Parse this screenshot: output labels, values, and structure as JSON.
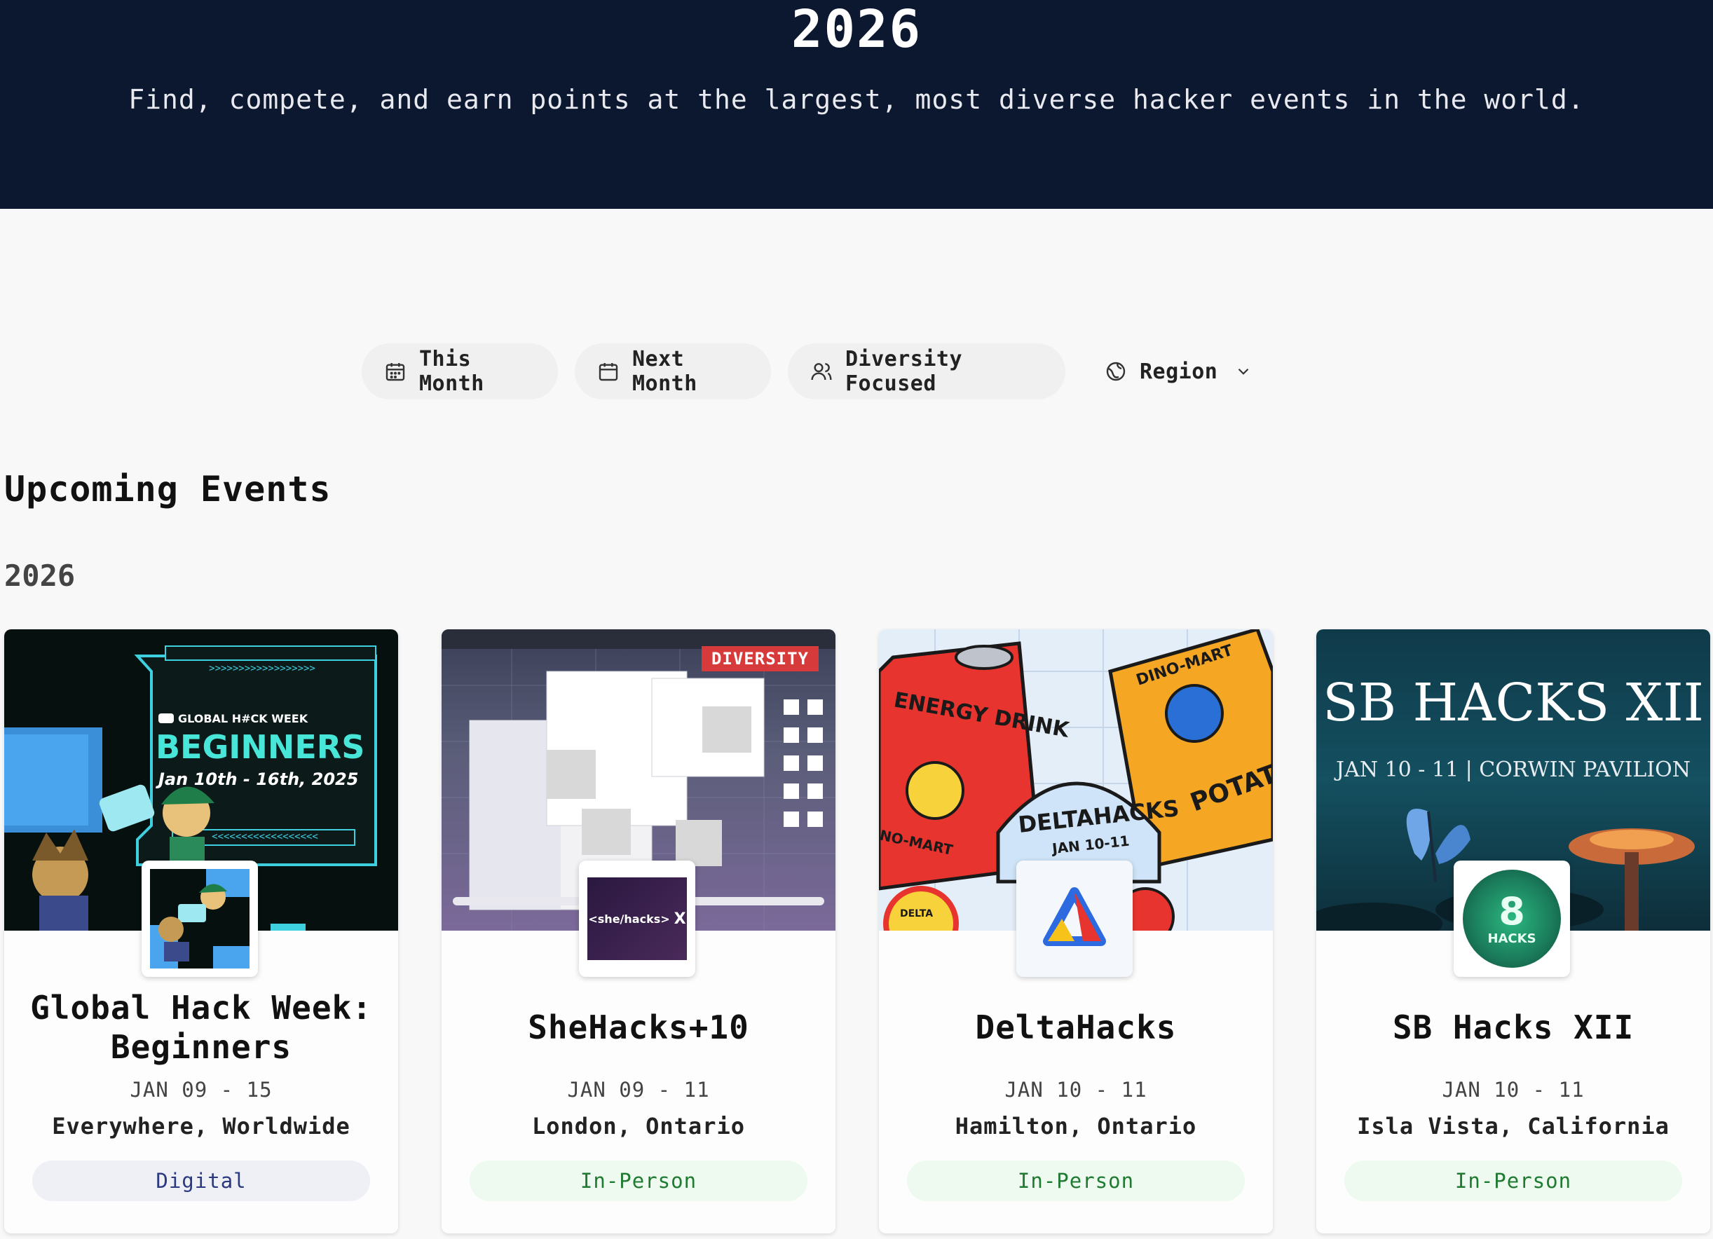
{
  "hero": {
    "title": "2026",
    "subtitle": "Find, compete, and earn points at the largest, most diverse hacker events in the world."
  },
  "filters": [
    {
      "label": "This Month",
      "icon": "calendar-icon"
    },
    {
      "label": "Next Month",
      "icon": "calendar-icon"
    },
    {
      "label": "Diversity Focused",
      "icon": "users-icon"
    },
    {
      "label": "Region",
      "icon": "globe-icon"
    }
  ],
  "section_title": "Upcoming Events",
  "year": "2026",
  "events": [
    {
      "name": "Global Hack Week: Beginners",
      "date": "JAN 09 - 15",
      "location": "Everywhere, Worldwide",
      "format": "Digital",
      "banner": {
        "brand": "GLOBAL H#CK WEEK",
        "headline": "BEGINNERS",
        "dates": "Jan 10th - 16th, 2025",
        "arrows_top": ">>>>>>>>>>>>>>>>>>",
        "arrows_bottom": "<<<<<<<<<<<<<<<<<<"
      }
    },
    {
      "name": "SheHacks+10",
      "date": "JAN 09 - 11",
      "location": "London, Ontario",
      "format": "In-Person",
      "ribbon": "DIVERSITY",
      "logo_text": "<she/hacks>",
      "logo_mark": "X"
    },
    {
      "name": "DeltaHacks",
      "date": "JAN 10 - 11",
      "location": "Hamilton, Ontario",
      "format": "In-Person",
      "banner": {
        "can_text": "ENERGY DRINK",
        "chips_brand": "DINO-MART",
        "chips_text": "POTATO CHI",
        "mart_text": "NO-MART",
        "title": "DELTAHACKS",
        "dates": "JAN 10-11",
        "badge": "DELTA"
      }
    },
    {
      "name": "SB Hacks XII",
      "date": "JAN 10 - 11",
      "location": "Isla Vista, California",
      "format": "In-Person",
      "banner": {
        "title": "SB HACKS XII",
        "subtitle": "JAN 10 - 11 | CORWIN PAVILION"
      },
      "logo_text": "HACKS",
      "logo_mark": "8"
    }
  ],
  "colors": {
    "hero_bg": "#0c1730",
    "digital_tag": "#2b3a80",
    "inperson_tag": "#1f7a32",
    "diversity_ribbon": "#d63a3a"
  }
}
